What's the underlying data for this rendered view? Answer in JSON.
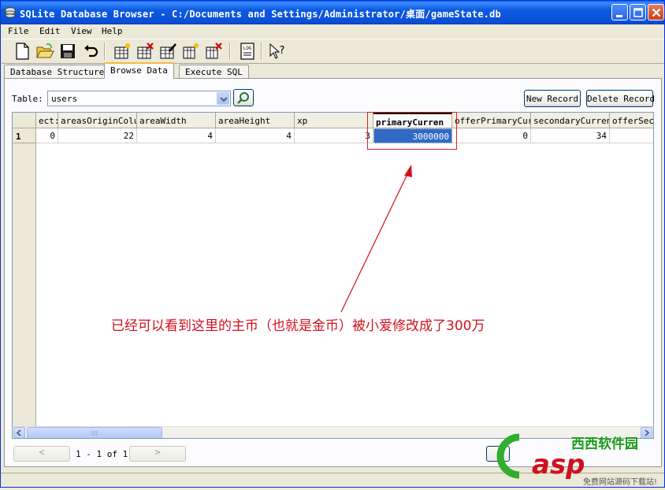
{
  "window": {
    "title": "SQLite Database Browser - C:/Documents and Settings/Administrator/桌面/gameState.db"
  },
  "menu": [
    "File",
    "Edit",
    "View",
    "Help"
  ],
  "tabs": [
    {
      "label": "Database Structure",
      "active": false
    },
    {
      "label": "Browse Data",
      "active": true
    },
    {
      "label": "Execute SQL",
      "active": false
    }
  ],
  "browse": {
    "table_label": "Table:",
    "table_value": "users",
    "new_record": "New Record",
    "delete_record": "Delete Record"
  },
  "grid": {
    "columns": [
      "ect:",
      "areasOriginColum",
      "areaWidth",
      "areaHeight",
      "xp",
      "primaryCurren",
      "offerPrimaryCurr",
      "secondaryCurrenc",
      "offerSeco"
    ],
    "selected_column": "primaryCurren",
    "rows": [
      {
        "row_number": "1",
        "cells": [
          "0",
          "22",
          "4",
          "4",
          "3",
          "3000000",
          "0",
          "34",
          ""
        ]
      }
    ],
    "selected_cell_value": "3000000"
  },
  "pagination": {
    "prev": "<",
    "next": ">",
    "range": "1 - 1 of 1"
  },
  "annotation": {
    "text": "已经可以看到这里的主币（也就是金币）被小爱修改成了300万"
  },
  "watermark": {
    "brand_cn": "西西软件园",
    "brand_en": "asp",
    "slogan": "免费网站源码下载站!"
  },
  "colors": {
    "titlebar": "#0a4fd6",
    "selection": "#316ac5",
    "annotation": "#d0101f"
  }
}
